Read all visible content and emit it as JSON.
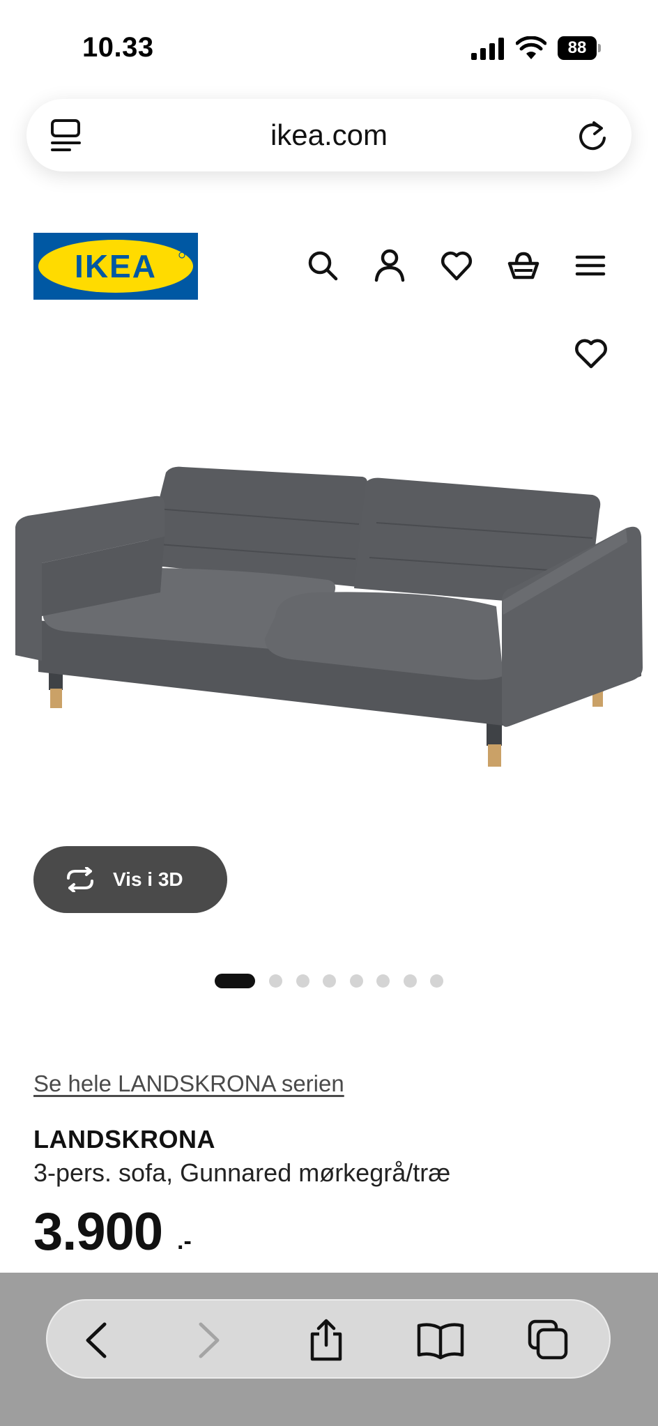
{
  "status_bar": {
    "time": "10.33",
    "battery": "88"
  },
  "browser": {
    "url": "ikea.com",
    "reader_icon": "reader-icon",
    "reload_icon": "reload-icon"
  },
  "header": {
    "logo_text": "IKEA",
    "brand_colors": {
      "blue": "#0058A3",
      "yellow": "#FFDB00"
    },
    "icons": [
      "search-icon",
      "user-icon",
      "heart-icon",
      "basket-icon",
      "menu-icon"
    ]
  },
  "gallery": {
    "view_3d_label": "Vis i 3D",
    "slide_count": 8,
    "active_slide": 1
  },
  "product": {
    "series_link": "Se hele LANDSKRONA serien",
    "name": "LANDSKRONA",
    "description": "3-pers. sofa, Gunnared mørkegrå/træ",
    "price": "3.900",
    "price_suffix": ".-"
  },
  "toolbar": {
    "icons": [
      "back-icon",
      "forward-icon",
      "share-icon",
      "bookmarks-icon",
      "tabs-icon"
    ]
  },
  "colors": {
    "button_dark": "#4a4a4a",
    "toolbar_bg": "#9e9e9e"
  }
}
